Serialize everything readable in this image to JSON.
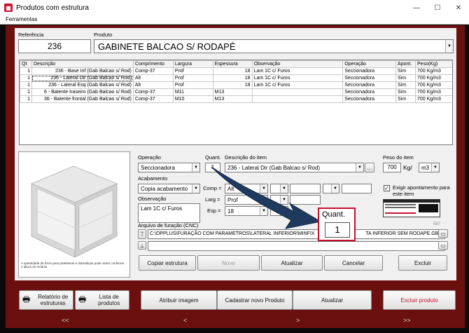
{
  "window": {
    "title": "Produtos com estrutura"
  },
  "menu": {
    "items": [
      "Ferramentas"
    ]
  },
  "header": {
    "referencia_label": "Referência",
    "referencia_value": "236",
    "produto_label": "Produto",
    "produto_value": "GABINETE BALCAO S/ RODAPÉ"
  },
  "table": {
    "columns": [
      "Qt",
      "Descrição",
      "Comprimento",
      "Largura",
      "Espessura",
      "Observação",
      "Operação",
      "Apont.",
      "Peso(Kg)"
    ],
    "rows": [
      [
        "1",
        "236 - Base Inf (Gab Balcao s/ Rod)",
        "Comp-37",
        "Prof",
        "18",
        "Lam 1C c/ Furos",
        "Seccionadora",
        "Sim",
        "700 Kg/m3"
      ],
      [
        "1",
        "236 - Lateral Dir (Gab Balcao s/ Rod)",
        "Alt",
        "Prof",
        "18",
        "Lam 1C c/ Furos",
        "Seccionadora",
        "Sim",
        "700 Kg/m3"
      ],
      [
        "1",
        "236 - Lateral Esq (Gab Balcao s/ Rod)",
        "Alt",
        "Prof",
        "18",
        "Lam 1C c/ Furos",
        "Seccionadora",
        "Sim",
        "700 Kg/m3"
      ],
      [
        "1",
        "6 - Batente traseiro (Gab Balcao s/ Rod)",
        "Comp-37",
        "M11",
        "M13",
        "",
        "Seccionadora",
        "Sim",
        "700 Kg/m3"
      ],
      [
        "1",
        "36 - Batente frontal (Gab Balcao s/ Rod)",
        "Comp-37",
        "M10",
        "M13",
        "",
        "Seccionadora",
        "Sim",
        "700 Kg/m3"
      ]
    ]
  },
  "preview": {
    "caption": "A quantidade de furos para prateleiras e dobradiças pode variar conforme o altura do módulo"
  },
  "form": {
    "operacao_label": "Operação",
    "operacao_value": "Seccionadora",
    "quant_label": "Quant.",
    "quant_value": "1",
    "descricao_label": "Descrição do item",
    "descricao_value": "236 - Lateral Dir (Gab Balcao s/ Rod)",
    "peso_label": "Peso do item",
    "peso_value": "700",
    "peso_unit1": "Kg/",
    "peso_unit2": "m3",
    "acabamento_label": "Acabamento",
    "acabamento_value": "Copia acabamento",
    "comp_label": "Comp =",
    "comp_value": "Alt",
    "larg_label": "Larg =",
    "larg_value": "Prof",
    "esp_label": "Esp =",
    "esp_value": "18",
    "observacao_label": "Observação",
    "observacao_value": "Lam 1C c/ Furos",
    "exigir_label": "Exigir apontamento para este item",
    "arquivo_label": "Arquivo de furação (CNC)",
    "arquivo_value": "C:\\OPPLUS\\FURAÇÃO COM PARAMETROS\\LATERAL INFERIOR\\MINFIX",
    "arquivo_value2": "TA INFERIOR SEM RODAPE.GBS",
    "arquivo_suffix": "587"
  },
  "callout": {
    "label": "Quant.",
    "value": "1"
  },
  "buttons": {
    "copiar": "Copiar estrutura",
    "novo": "Novo",
    "atualizar": "Atualizar",
    "cancelar": "Cancelar",
    "excluir": "Excluir",
    "relatorio": "Relatório de estruturas",
    "lista": "Lista de produtos",
    "atribuir": "Atribuir imagem",
    "cadastrar": "Cadastrar novo Produto",
    "atualizar2": "Atualizar",
    "excluir_produto": "Excluir produto"
  },
  "nav": {
    "first": "<<",
    "prev": "<",
    "next": ">",
    "last": ">>"
  },
  "colors": {
    "frame": "#6b0f0f",
    "callout": "#c8102e",
    "arrow": "#1e3a5f"
  }
}
